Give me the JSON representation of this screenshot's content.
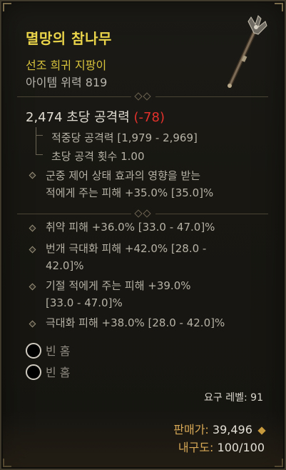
{
  "item": {
    "name": "멸망의 참나무",
    "type": "선조 희귀 지팡이",
    "power": "아이템 위력 819",
    "dps_value": "2,474 초당 공격력",
    "dps_delta": "(-78)",
    "damage_per_hit": "적중당 공격력 [1,979 - 2,969]",
    "attacks_per_second": "초당 공격 횟수 1.00",
    "implicit_line1": "군중 제어 상태 효과의 영향을 받는",
    "implicit_line2": "적에게 주는 피해 +35.0% [35.0]%",
    "affixes": [
      {
        "line1": "취약 피해 +36.0% [33.0 - 47.0]%",
        "line2": ""
      },
      {
        "line1": "번개 극대화 피해 +42.0% [28.0 -",
        "line2": "42.0]%"
      },
      {
        "line1": "기절 적에게 주는 피해 +39.0%",
        "line2": "[33.0 - 47.0]%"
      },
      {
        "line1": "극대화 피해 +38.0% [28.0 - 42.0]%",
        "line2": ""
      }
    ],
    "sockets": [
      "빈 홈",
      "빈 홈"
    ],
    "required_level": "요구 레벨: 91",
    "sell_label": "판매가:",
    "sell_value": "39,496",
    "durability_label": "내구도:",
    "durability_value": "100/100"
  },
  "colors": {
    "name": "#e9d44a",
    "negative": "#e4312c",
    "text": "#b6b2a6",
    "footer_key": "#d8a956"
  },
  "icons": [
    "staff-weapon-icon",
    "gold-coin-icon",
    "bullet-diamond-icon",
    "empty-socket-icon"
  ]
}
